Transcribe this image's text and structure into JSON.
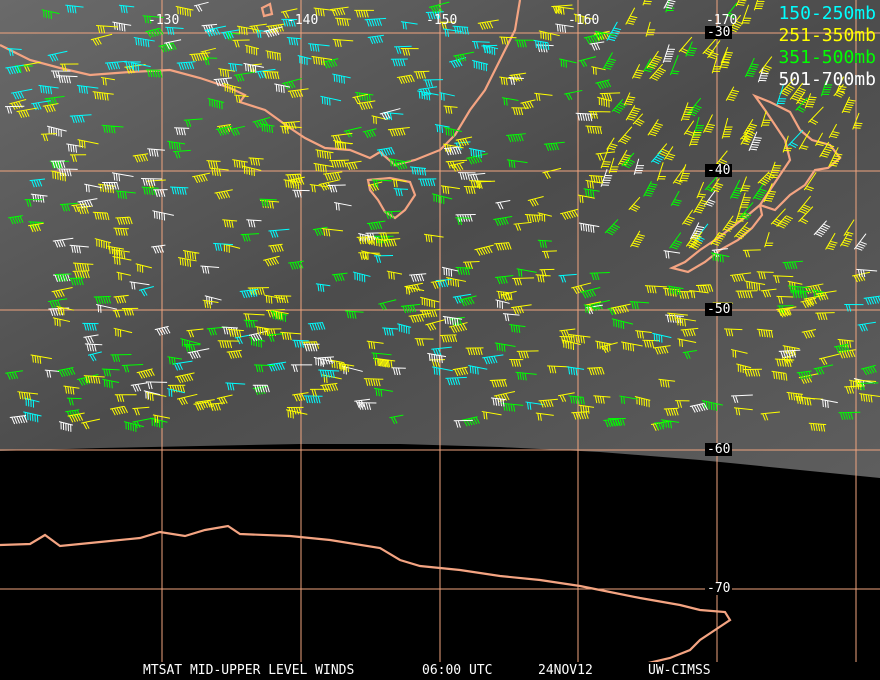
{
  "map": {
    "longitude_labels": [
      "-130",
      "-140",
      "-150",
      "-160",
      "-170"
    ],
    "latitude_labels": [
      "-30",
      "-40",
      "-50",
      "-60",
      "-70"
    ]
  },
  "legend": [
    {
      "label": "150-250mb",
      "color": "#00ffff"
    },
    {
      "label": "251-350mb",
      "color": "#ffff00"
    },
    {
      "label": "351-500mb",
      "color": "#00ff00"
    },
    {
      "label": "501-700mb",
      "color": "#ffffff"
    }
  ],
  "footer": {
    "product": "MTSAT MID-UPPER LEVEL WINDS",
    "time": "06:00 UTC",
    "date": "24NOV12",
    "source": "UW-CIMSS"
  },
  "colors": {
    "grid": "#f0a47e",
    "coast": "#f4a482",
    "background_cloud": "#555555"
  }
}
